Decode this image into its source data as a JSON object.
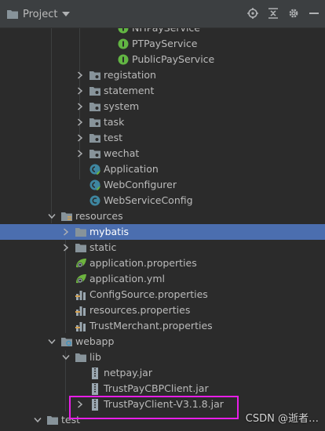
{
  "toolbar": {
    "title": "Project",
    "icons": [
      "folder-icon",
      "dropdown-caret-icon",
      "locate-icon",
      "collapse-all-icon",
      "gear-icon",
      "hide-icon"
    ]
  },
  "tree": {
    "items": [
      {
        "label": "NHPayService",
        "type": "interface",
        "indent": 150,
        "chevron": "none"
      },
      {
        "label": "PTPayService",
        "type": "interface",
        "indent": 150,
        "chevron": "none"
      },
      {
        "label": "PublicPayService",
        "type": "interface",
        "indent": 150,
        "chevron": "none"
      },
      {
        "label": "registation",
        "type": "package",
        "indent": 114,
        "chevron": "closed"
      },
      {
        "label": "statement",
        "type": "package",
        "indent": 114,
        "chevron": "closed"
      },
      {
        "label": "system",
        "type": "package",
        "indent": 114,
        "chevron": "closed"
      },
      {
        "label": "task",
        "type": "package",
        "indent": 114,
        "chevron": "closed"
      },
      {
        "label": "test",
        "type": "package",
        "indent": 114,
        "chevron": "closed"
      },
      {
        "label": "wechat",
        "type": "package",
        "indent": 114,
        "chevron": "closed"
      },
      {
        "label": "Application",
        "type": "spring-class",
        "indent": 114,
        "chevron": "none"
      },
      {
        "label": "WebConfigurer",
        "type": "spring-class",
        "indent": 114,
        "chevron": "none"
      },
      {
        "label": "WebServiceConfig",
        "type": "class",
        "indent": 114,
        "chevron": "none"
      },
      {
        "label": "resources",
        "type": "resources-folder",
        "indent": 78,
        "chevron": "open"
      },
      {
        "label": "mybatis",
        "type": "folder",
        "indent": 96,
        "chevron": "closed",
        "selected": true
      },
      {
        "label": "static",
        "type": "folder",
        "indent": 96,
        "chevron": "closed"
      },
      {
        "label": "application.properties",
        "type": "spring-config",
        "indent": 96,
        "chevron": "none"
      },
      {
        "label": "application.yml",
        "type": "spring-config",
        "indent": 96,
        "chevron": "none"
      },
      {
        "label": "ConfigSource.properties",
        "type": "properties",
        "indent": 96,
        "chevron": "none"
      },
      {
        "label": "resources.properties",
        "type": "properties",
        "indent": 96,
        "chevron": "none"
      },
      {
        "label": "TrustMerchant.properties",
        "type": "properties",
        "indent": 96,
        "chevron": "none"
      },
      {
        "label": "webapp",
        "type": "web-folder",
        "indent": 78,
        "chevron": "open"
      },
      {
        "label": "lib",
        "type": "folder",
        "indent": 96,
        "chevron": "open"
      },
      {
        "label": "netpay.jar",
        "type": "jar",
        "indent": 114,
        "chevron": "none"
      },
      {
        "label": "TrustPayCBPClient.jar",
        "type": "jar",
        "indent": 114,
        "chevron": "none"
      },
      {
        "label": "TrustPayClient-V3.1.8.jar",
        "type": "jar",
        "indent": 114,
        "chevron": "closed"
      },
      {
        "label": "test",
        "type": "folder",
        "indent": 60,
        "chevron": "open"
      }
    ]
  },
  "watermark": "CSDN @逝者…",
  "colors": {
    "background": "#2b2b2b",
    "toolbar": "#3c3f41",
    "selection": "#4b6eaf",
    "highlight": "#e81ee8",
    "folder": "#87939a",
    "interface": "#62b543",
    "class": "#3e86a0",
    "jar": "#9aa7b0"
  }
}
